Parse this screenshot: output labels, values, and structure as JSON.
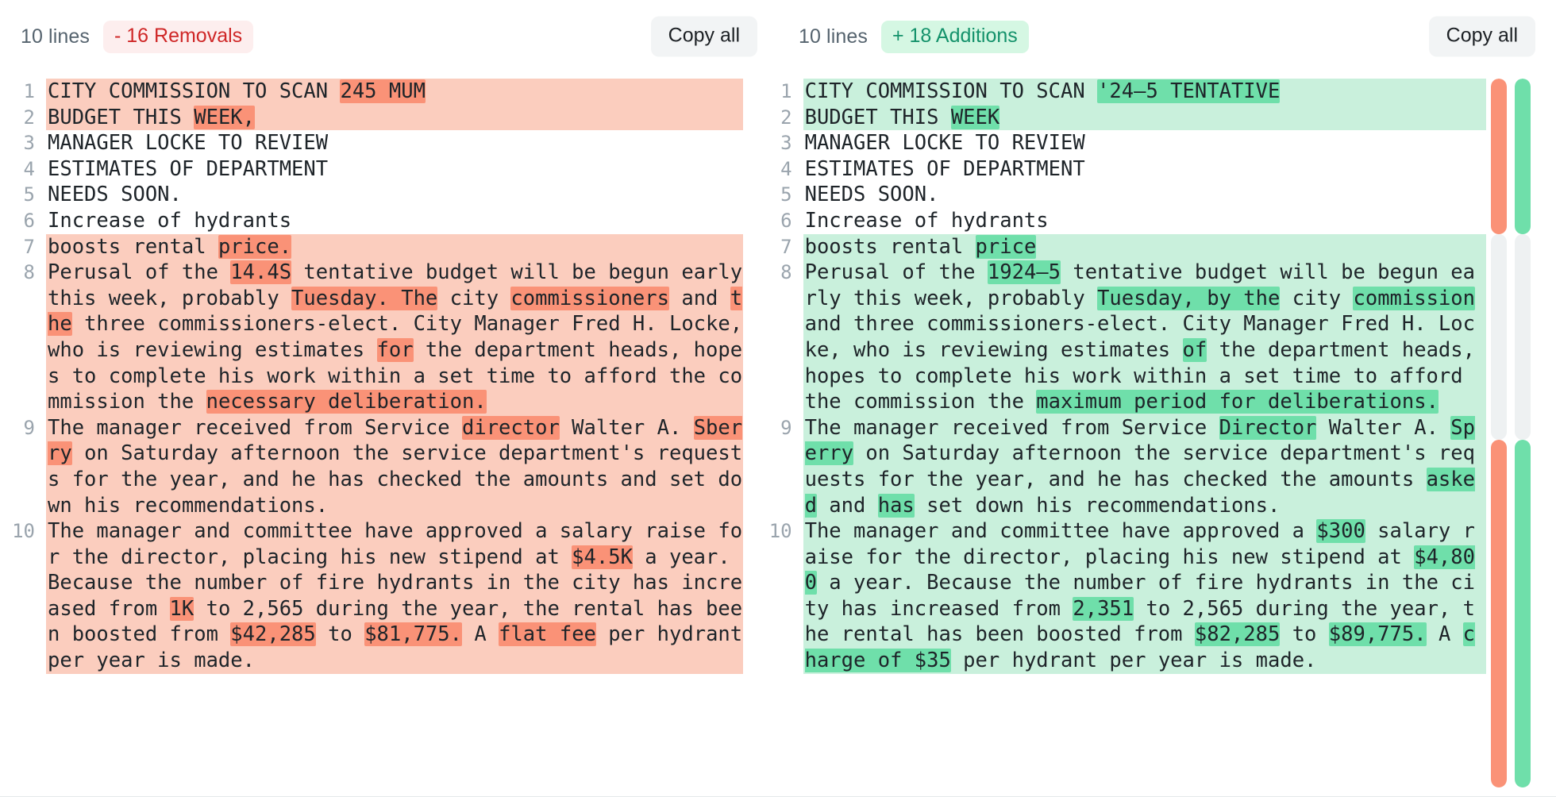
{
  "left_header": {
    "lines_label": "10 lines",
    "stat_badge": "- 16 Removals",
    "copy_label": "Copy all"
  },
  "right_header": {
    "lines_label": "10 lines",
    "stat_badge": "+ 18 Additions",
    "copy_label": "Copy all"
  },
  "colors": {
    "removal_line_bg": "#fbcdbe",
    "removal_word_bg": "#fa9277",
    "addition_line_bg": "#c9f0dc",
    "addition_word_bg": "#6fdfaa",
    "removal_badge_bg": "#fdeeee",
    "removal_badge_fg": "#cf2727",
    "addition_badge_bg": "#d5f7e3",
    "addition_badge_fg": "#14926b",
    "gutter_fg": "#9aa4ad",
    "code_fg": "#1e2429",
    "button_bg": "#f2f4f5"
  },
  "left_pane": {
    "rows": [
      {
        "num": "1",
        "type": "rem",
        "parts": [
          {
            "t": "CITY COMMISSION TO SCAN ",
            "h": false
          },
          {
            "t": "245 MUM",
            "h": true
          }
        ]
      },
      {
        "num": "2",
        "type": "rem",
        "parts": [
          {
            "t": "BUDGET THIS ",
            "h": false
          },
          {
            "t": "WEEK,",
            "h": true
          }
        ]
      },
      {
        "num": "3",
        "type": "ctx",
        "parts": [
          {
            "t": "MANAGER LOCKE TO REVIEW",
            "h": false
          }
        ]
      },
      {
        "num": "4",
        "type": "ctx",
        "parts": [
          {
            "t": "ESTIMATES OF DEPARTMENT",
            "h": false
          }
        ]
      },
      {
        "num": "5",
        "type": "ctx",
        "parts": [
          {
            "t": "NEEDS SOON.",
            "h": false
          }
        ]
      },
      {
        "num": "6",
        "type": "ctx",
        "parts": [
          {
            "t": "Increase of hydrants",
            "h": false
          }
        ]
      },
      {
        "num": "7",
        "type": "rem",
        "parts": [
          {
            "t": "boosts rental ",
            "h": false
          },
          {
            "t": "price.",
            "h": true
          }
        ]
      },
      {
        "num": "8",
        "type": "rem",
        "parts": [
          {
            "t": "Perusal of the ",
            "h": false
          },
          {
            "t": "14.4S",
            "h": true
          },
          {
            "t": " tentative budget will be begun early this week, probably ",
            "h": false
          },
          {
            "t": "Tuesday. The",
            "h": true
          },
          {
            "t": " city ",
            "h": false
          },
          {
            "t": "commissioners",
            "h": true
          },
          {
            "t": " and ",
            "h": false
          },
          {
            "t": "the",
            "h": true
          },
          {
            "t": " three commissioners-elect. City Manager Fred H. Locke, who is reviewing estimates ",
            "h": false
          },
          {
            "t": "for",
            "h": true
          },
          {
            "t": " the department heads, hopes to complete his work within a set time to afford the commission the ",
            "h": false
          },
          {
            "t": "necessary deliberation.",
            "h": true
          }
        ]
      },
      {
        "num": "9",
        "type": "rem",
        "parts": [
          {
            "t": "The manager received from Service ",
            "h": false
          },
          {
            "t": "director",
            "h": true
          },
          {
            "t": " Walter A. ",
            "h": false
          },
          {
            "t": "Sberry",
            "h": true
          },
          {
            "t": " on Saturday afternoon the service department's requests for the year, and he has checked the amounts and set down his recommendations.",
            "h": false
          }
        ]
      },
      {
        "num": "10",
        "type": "rem",
        "parts": [
          {
            "t": "The manager and committee have approved a salary raise for the director, placing his new stipend at ",
            "h": false
          },
          {
            "t": "$4.5K",
            "h": true
          },
          {
            "t": " a year. Because the number of fire hydrants in the city has increased from ",
            "h": false
          },
          {
            "t": "1K",
            "h": true
          },
          {
            "t": " to 2,565 during the year, the rental has been boosted from ",
            "h": false
          },
          {
            "t": "$42,285",
            "h": true
          },
          {
            "t": " to ",
            "h": false
          },
          {
            "t": "$81,775.",
            "h": true
          },
          {
            "t": " A ",
            "h": false
          },
          {
            "t": "flat fee",
            "h": true
          },
          {
            "t": " per hydrant per year is made.",
            "h": false
          }
        ]
      }
    ]
  },
  "right_pane": {
    "rows": [
      {
        "num": "1",
        "type": "add",
        "parts": [
          {
            "t": "CITY COMMISSION TO SCAN ",
            "h": false
          },
          {
            "t": "'24–5 TENTATIVE",
            "h": true
          }
        ]
      },
      {
        "num": "2",
        "type": "add",
        "parts": [
          {
            "t": "BUDGET THIS ",
            "h": false
          },
          {
            "t": "WEEK",
            "h": true
          }
        ]
      },
      {
        "num": "3",
        "type": "ctx",
        "parts": [
          {
            "t": "MANAGER LOCKE TO REVIEW",
            "h": false
          }
        ]
      },
      {
        "num": "4",
        "type": "ctx",
        "parts": [
          {
            "t": "ESTIMATES OF DEPARTMENT",
            "h": false
          }
        ]
      },
      {
        "num": "5",
        "type": "ctx",
        "parts": [
          {
            "t": "NEEDS SOON.",
            "h": false
          }
        ]
      },
      {
        "num": "6",
        "type": "ctx",
        "parts": [
          {
            "t": "Increase of hydrants",
            "h": false
          }
        ]
      },
      {
        "num": "7",
        "type": "add",
        "parts": [
          {
            "t": "boosts rental ",
            "h": false
          },
          {
            "t": "price",
            "h": true
          }
        ]
      },
      {
        "num": "8",
        "type": "add",
        "parts": [
          {
            "t": "Perusal of the ",
            "h": false
          },
          {
            "t": "1924–5",
            "h": true
          },
          {
            "t": " tentative budget will be begun early this week, probably ",
            "h": false
          },
          {
            "t": "Tuesday, by the",
            "h": true
          },
          {
            "t": " city ",
            "h": false
          },
          {
            "t": "commission",
            "h": true
          },
          {
            "t": " and three commissioners-elect. City Manager Fred H. Locke, who is reviewing estimates ",
            "h": false
          },
          {
            "t": "of",
            "h": true
          },
          {
            "t": " the department heads, hopes to complete his work within a set time to afford the commission the ",
            "h": false
          },
          {
            "t": "maximum period for deliberations.",
            "h": true
          }
        ]
      },
      {
        "num": "9",
        "type": "add",
        "parts": [
          {
            "t": "The manager received from Service ",
            "h": false
          },
          {
            "t": "Director",
            "h": true
          },
          {
            "t": " Walter A. ",
            "h": false
          },
          {
            "t": "Sperry",
            "h": true
          },
          {
            "t": " on Saturday afternoon the service department's requests for the year, and he has checked the amounts ",
            "h": false
          },
          {
            "t": "asked",
            "h": true
          },
          {
            "t": " and ",
            "h": false
          },
          {
            "t": "has",
            "h": true
          },
          {
            "t": " set down his recommendations.",
            "h": false
          }
        ]
      },
      {
        "num": "10",
        "type": "add",
        "parts": [
          {
            "t": "The manager and committee have approved a ",
            "h": false
          },
          {
            "t": "$300",
            "h": true
          },
          {
            "t": " salary raise for the director, placing his new stipend at ",
            "h": false
          },
          {
            "t": "$4,800",
            "h": true
          },
          {
            "t": " a year. Because the number of fire hydrants in the city has increased from ",
            "h": false
          },
          {
            "t": "2,351",
            "h": true
          },
          {
            "t": " to 2,565 during the year, the rental has been boosted from ",
            "h": false
          },
          {
            "t": "$82,285",
            "h": true
          },
          {
            "t": " to ",
            "h": false
          },
          {
            "t": "$89,775.",
            "h": true
          },
          {
            "t": " A ",
            "h": false
          },
          {
            "t": "charge of $35",
            "h": true
          },
          {
            "t": " per hydrant per year is made.",
            "h": false
          }
        ]
      }
    ]
  },
  "minimaps": [
    {
      "name": "removals-minimap",
      "segments": [
        {
          "color": "#fa9277",
          "flex": 22
        },
        {
          "color": "#eef1f2",
          "flex": 29
        },
        {
          "color": "#fa9277",
          "flex": 49
        }
      ]
    },
    {
      "name": "additions-minimap",
      "segments": [
        {
          "color": "#6fdfaa",
          "flex": 22
        },
        {
          "color": "#eef1f2",
          "flex": 29
        },
        {
          "color": "#6fdfaa",
          "flex": 49
        }
      ]
    }
  ]
}
